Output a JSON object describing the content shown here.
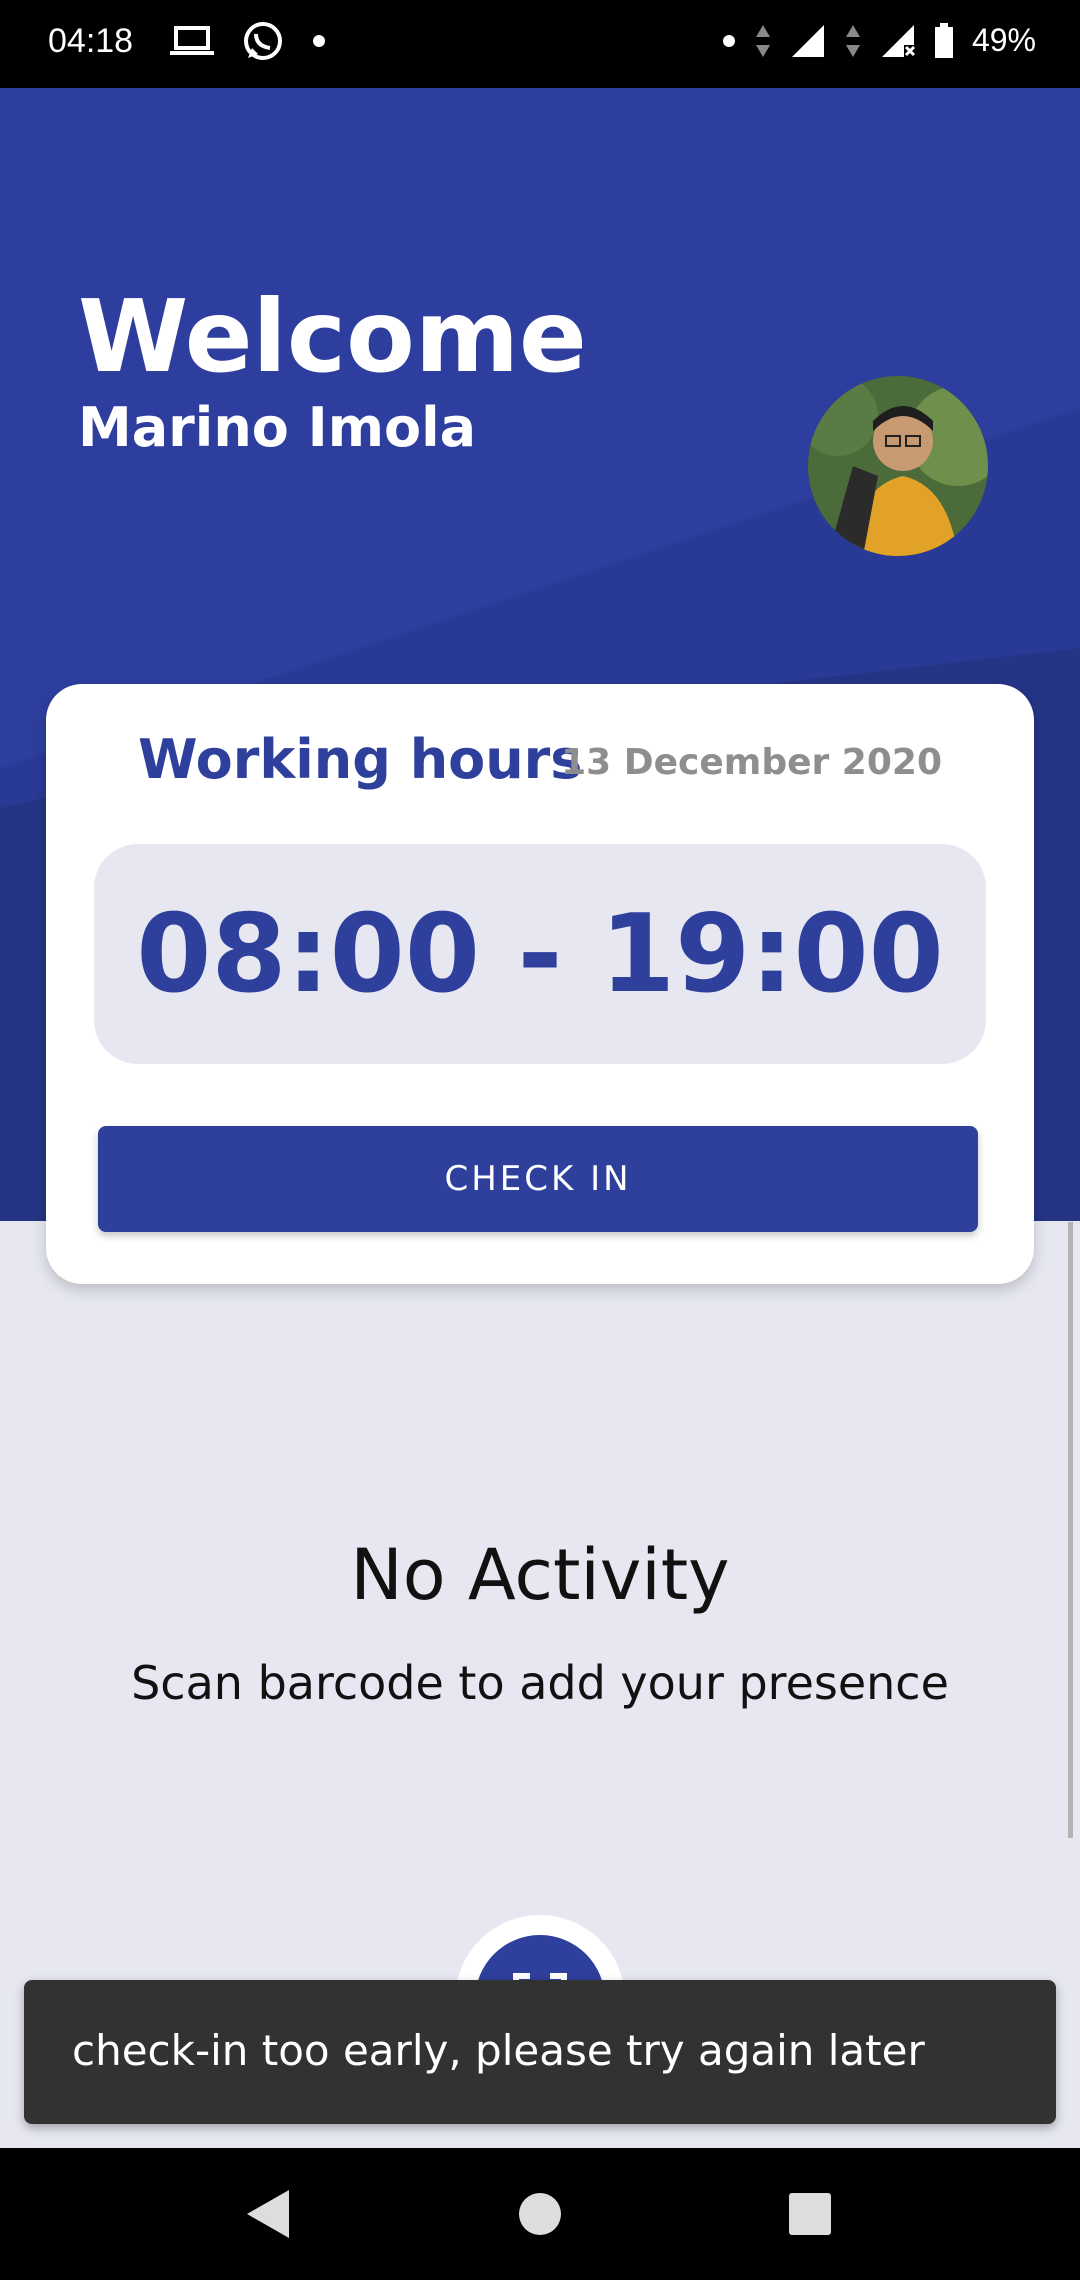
{
  "status_bar": {
    "time": "04:18",
    "battery": "49%",
    "icons_left": [
      "laptop-icon",
      "whatsapp-icon",
      "dot-icon"
    ],
    "icons_right": [
      "dot-icon",
      "data-arrows-icon",
      "signal-icon",
      "signal-no-data-icon",
      "battery-icon"
    ]
  },
  "header": {
    "title": "Welcome",
    "user_name": "Marino Imola"
  },
  "working_hours": {
    "title": "Working hours",
    "date": "13 December 2020",
    "time_range": "08:00 - 19:00",
    "check_in_label": "CHECK IN"
  },
  "activity": {
    "empty_title": "No Activity",
    "empty_subtitle": "Scan barcode to add your presence"
  },
  "snackbar": {
    "message": "check-in too early, please try again later"
  },
  "nav": {
    "icons": [
      "back-icon",
      "home-icon",
      "recents-icon"
    ]
  },
  "colors": {
    "primary": "#2f3f9c",
    "hero_dark": "#27347f",
    "background": "#e6e7f0",
    "snackbar": "#323232"
  }
}
